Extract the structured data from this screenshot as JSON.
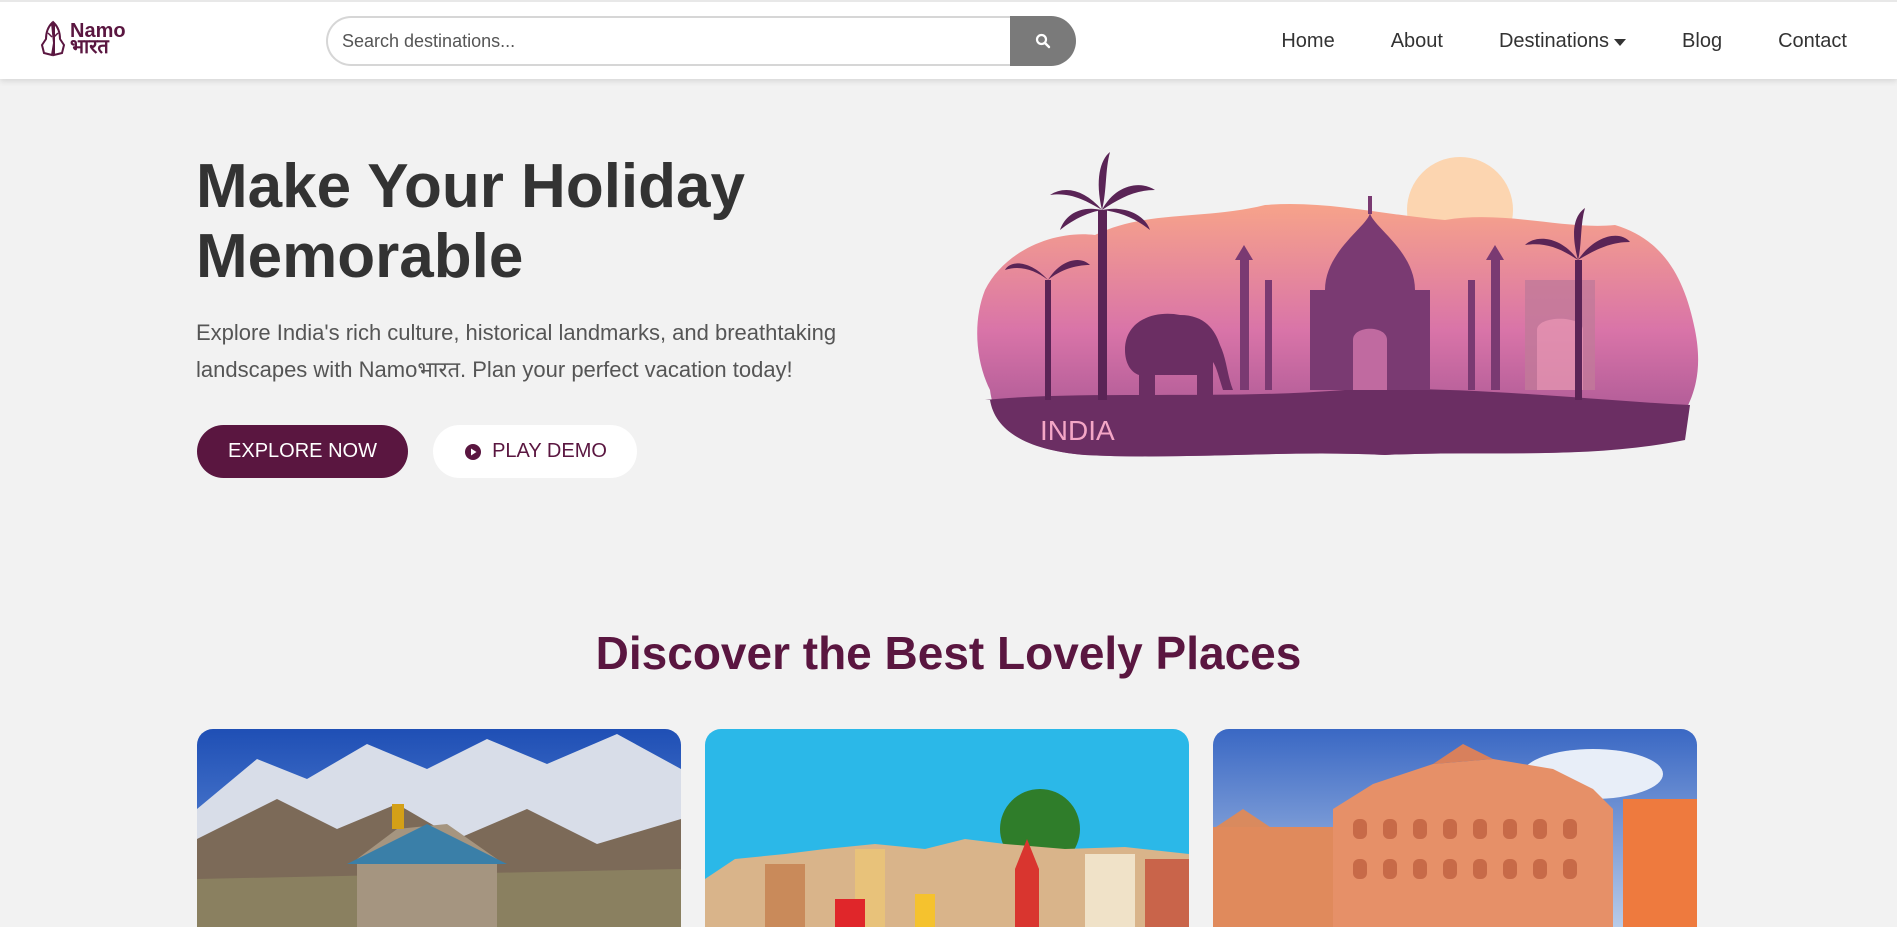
{
  "header": {
    "logo_line1": "Namo",
    "logo_line2": "भारत",
    "search_placeholder": "Search destinations...",
    "nav": [
      {
        "label": "Home"
      },
      {
        "label": "About"
      },
      {
        "label": "Destinations"
      },
      {
        "label": "Blog"
      },
      {
        "label": "Contact"
      }
    ]
  },
  "hero": {
    "title": "Make Your Holiday Memorable",
    "description": "Explore India's rich culture, historical landmarks, and breathtaking landscapes with Namoभारत. Plan your perfect vacation today!",
    "explore_label": "EXPLORE NOW",
    "demo_label": "PLAY DEMO",
    "art_label": "INDIA"
  },
  "section": {
    "title": "Discover the Best Lovely Places"
  },
  "colors": {
    "brand": "#5a1640",
    "background": "#f2f2f2",
    "search_button": "#7a7a7a"
  },
  "icons": [
    "praying-hands-logo-icon",
    "search-icon",
    "caret-down-icon",
    "play-circle-icon"
  ]
}
